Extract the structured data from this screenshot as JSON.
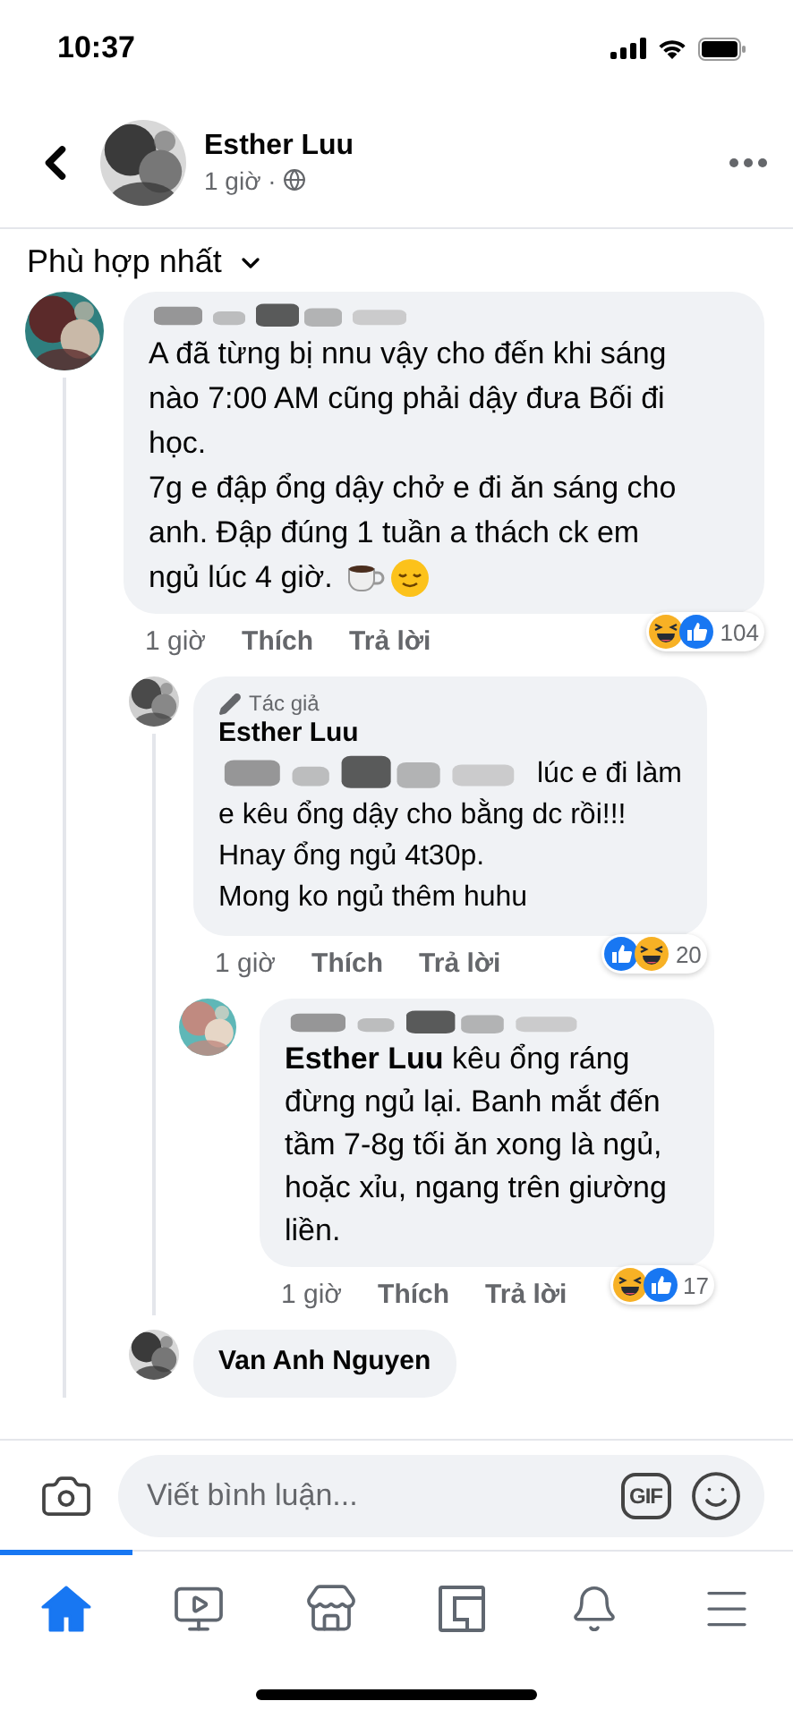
{
  "status_bar": {
    "time": "10:37"
  },
  "post_header": {
    "name": "Esther Luu",
    "time": "1 giờ ·"
  },
  "sort": {
    "label": "Phù hợp nhất"
  },
  "comments": [
    {
      "author_scribbled": true,
      "paragraphs": [
        "A đã từng bị nnu vậy cho đến khi sáng nào 7:00 AM cũng phải dậy đưa Bối đi học.",
        "7g e đập ổng dậy chở e đi ăn sáng cho anh. Đập đúng 1 tuần a thách ck em",
        "ngủ lúc 4 giờ."
      ],
      "emoji": [
        {
          "kind": "coffee"
        },
        {
          "kind": "relieved"
        }
      ],
      "time": "1 giờ",
      "actions": [
        "Thích",
        "Trả lời"
      ],
      "reactions": [
        {
          "kind": "haha"
        },
        {
          "kind": "like"
        }
      ],
      "reaction_count": "104",
      "replies": [
        {
          "author_badge": "Tác giả",
          "author": "Esther Luu",
          "scribbled_prefix": true,
          "paragraphs": [
            "lúc e đi làm",
            "e kêu ổng dậy cho bằng dc rồi!!!",
            "Hnay ổng ngủ 4t30p.",
            "Mong ko ngủ thêm huhu"
          ],
          "time": "1 giờ",
          "actions": [
            "Thích",
            "Trả lời"
          ],
          "reactions": [
            {
              "kind": "like"
            },
            {
              "kind": "haha"
            }
          ],
          "reaction_count": "20",
          "replies": [
            {
              "author_scribbled": true,
              "paragraphs": [
                "**Esther Luu** kêu ổng ráng đừng ngủ lại. Banh mắt đến tầm 7-8g tối ăn xong là ngủ, hoặc xỉu, ngang trên giường liền."
              ],
              "time": "1 giờ",
              "actions": [
                "Thích",
                "Trả lời"
              ],
              "reactions": [
                {
                  "kind": "haha"
                },
                {
                  "kind": "like"
                }
              ],
              "reaction_count": "17"
            }
          ]
        },
        {
          "author": "Van Anh Nguyen"
        }
      ]
    }
  ],
  "composer": {
    "placeholder": "Viết bình luận...",
    "gif_label": "GIF"
  },
  "nav_tabs": [
    {
      "selected": true
    },
    {
      "selected": false
    },
    {
      "selected": false
    },
    {
      "selected": false
    },
    {
      "selected": false
    },
    {
      "selected": false
    }
  ]
}
